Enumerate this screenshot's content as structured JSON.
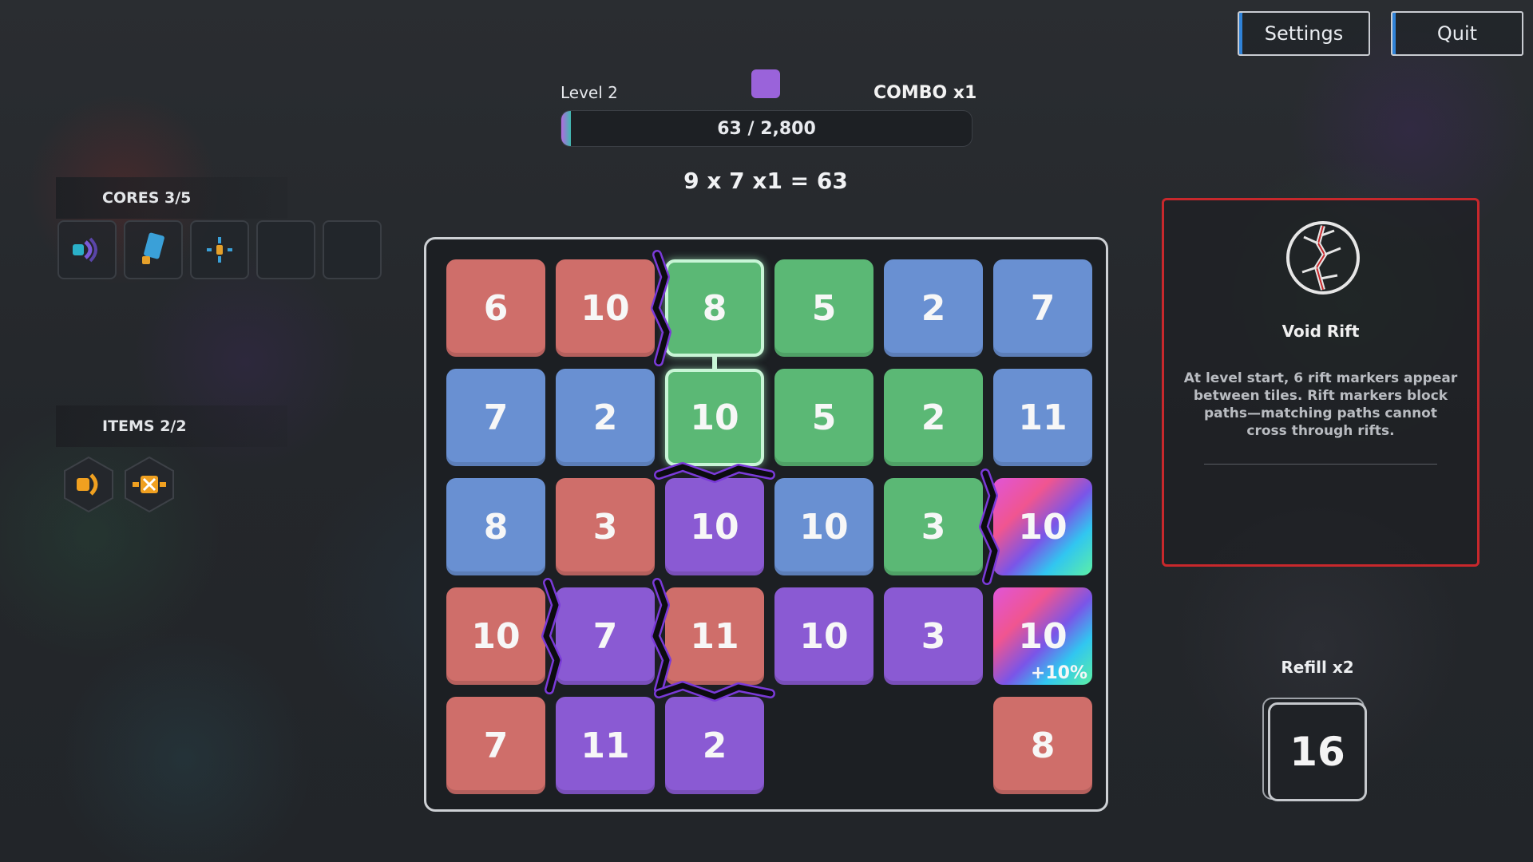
{
  "header": {
    "settings_label": "Settings",
    "quit_label": "Quit"
  },
  "hud": {
    "level_label": "Level 2",
    "combo_label": "COMBO x1",
    "next_color": "#9a63da",
    "progress_text": "63 / 2,800",
    "progress_value": 63,
    "progress_max": 2800,
    "formula": "9 x 7 x1 = 63"
  },
  "cores": {
    "title": "CORES 3/5",
    "slots": [
      {
        "icon": "speaker-core-icon",
        "filled": true
      },
      {
        "icon": "battery-core-icon",
        "filled": true
      },
      {
        "icon": "crosshair-core-icon",
        "filled": true
      },
      {
        "icon": "",
        "filled": false
      },
      {
        "icon": "",
        "filled": false
      }
    ]
  },
  "items": {
    "title": "ITEMS 2/2",
    "slots": [
      {
        "icon": "horn-item-icon"
      },
      {
        "icon": "crate-item-icon"
      }
    ]
  },
  "board": {
    "columns": 6,
    "rows": 5,
    "tiles": [
      {
        "row": 0,
        "col": 0,
        "value": "6",
        "color": "red"
      },
      {
        "row": 0,
        "col": 1,
        "value": "10",
        "color": "red"
      },
      {
        "row": 0,
        "col": 2,
        "value": "8",
        "color": "green",
        "selected": true
      },
      {
        "row": 0,
        "col": 3,
        "value": "5",
        "color": "green"
      },
      {
        "row": 0,
        "col": 4,
        "value": "2",
        "color": "blue"
      },
      {
        "row": 0,
        "col": 5,
        "value": "7",
        "color": "blue"
      },
      {
        "row": 1,
        "col": 0,
        "value": "7",
        "color": "blue"
      },
      {
        "row": 1,
        "col": 1,
        "value": "2",
        "color": "blue"
      },
      {
        "row": 1,
        "col": 2,
        "value": "10",
        "color": "green",
        "selected": true
      },
      {
        "row": 1,
        "col": 3,
        "value": "5",
        "color": "green"
      },
      {
        "row": 1,
        "col": 4,
        "value": "2",
        "color": "green"
      },
      {
        "row": 1,
        "col": 5,
        "value": "11",
        "color": "blue"
      },
      {
        "row": 2,
        "col": 0,
        "value": "8",
        "color": "blue"
      },
      {
        "row": 2,
        "col": 1,
        "value": "3",
        "color": "red"
      },
      {
        "row": 2,
        "col": 2,
        "value": "10",
        "color": "purple"
      },
      {
        "row": 2,
        "col": 3,
        "value": "10",
        "color": "blue"
      },
      {
        "row": 2,
        "col": 4,
        "value": "3",
        "color": "green"
      },
      {
        "row": 2,
        "col": 5,
        "value": "10",
        "color": "rainbow"
      },
      {
        "row": 3,
        "col": 0,
        "value": "10",
        "color": "red"
      },
      {
        "row": 3,
        "col": 1,
        "value": "7",
        "color": "purple"
      },
      {
        "row": 3,
        "col": 2,
        "value": "11",
        "color": "red"
      },
      {
        "row": 3,
        "col": 3,
        "value": "10",
        "color": "purple"
      },
      {
        "row": 3,
        "col": 4,
        "value": "3",
        "color": "purple"
      },
      {
        "row": 3,
        "col": 5,
        "value": "10",
        "color": "rainbow",
        "bonus": "+10%"
      },
      {
        "row": 4,
        "col": 0,
        "value": "7",
        "color": "red"
      },
      {
        "row": 4,
        "col": 1,
        "value": "11",
        "color": "purple"
      },
      {
        "row": 4,
        "col": 2,
        "value": "2",
        "color": "purple"
      },
      {
        "row": 4,
        "col": 5,
        "value": "8",
        "color": "red"
      }
    ],
    "rifts": [
      {
        "type": "vertical",
        "between": [
          [
            0,
            1
          ],
          [
            0,
            2
          ]
        ]
      },
      {
        "type": "horizontal",
        "between": [
          [
            1,
            2
          ],
          [
            2,
            2
          ]
        ]
      },
      {
        "type": "vertical",
        "between": [
          [
            2,
            4
          ],
          [
            2,
            5
          ]
        ]
      },
      {
        "type": "vertical",
        "between": [
          [
            3,
            0
          ],
          [
            3,
            1
          ]
        ]
      },
      {
        "type": "vertical",
        "between": [
          [
            3,
            1
          ],
          [
            3,
            2
          ]
        ]
      },
      {
        "type": "horizontal",
        "between": [
          [
            3,
            2
          ],
          [
            4,
            2
          ]
        ]
      }
    ]
  },
  "effect": {
    "title": "Void Rift",
    "icon": "void-rift-icon",
    "description": "At level start, 6 rift markers appear between tiles. Rift markers block paths—matching paths cannot cross through rifts.",
    "border_color": "#c8282c"
  },
  "refill": {
    "label": "Refill x2",
    "count": "16"
  },
  "colors": {
    "red": "#cf6e6a",
    "blue": "#6990d2",
    "green": "#5bb875",
    "purple": "#8a5ad3"
  }
}
